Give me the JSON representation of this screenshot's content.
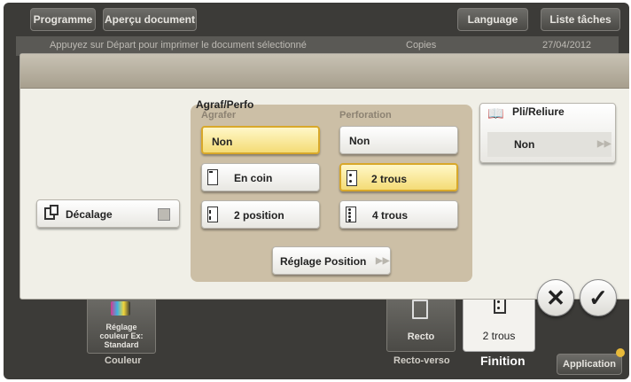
{
  "topbar": {
    "programme": "Programme",
    "apercu": "Aperçu document",
    "language": "Language",
    "liste_taches": "Liste tâches"
  },
  "jobstrip": {
    "message": "Appuyez sur Départ pour imprimer le document sélectionné",
    "copies": "Copies",
    "date": "27/04/2012"
  },
  "panel": {
    "group_title": "Agraf/Perfo",
    "agrafer": {
      "label": "Agrafer",
      "options": [
        "Non",
        "En coin",
        "2 position"
      ],
      "selected": "Non"
    },
    "perforation": {
      "label": "Perforation",
      "options": [
        "Non",
        "2 trous",
        "4 trous"
      ],
      "selected": "2 trous"
    },
    "reglage_position": "Réglage Position",
    "decalage": "Décalage",
    "pli_reliure": {
      "label": "Pli/Reliure",
      "value": "Non"
    }
  },
  "bottom": {
    "couleur_tile": "Réglage couleur Ex: Standard",
    "couleur_label": "Couleur",
    "recto_tile": "Recto",
    "recto_label": "Recto-verso",
    "finition_tile": "2 trous",
    "finition_label": "Finition",
    "application": "Application"
  },
  "icons": [
    "decalage-icon",
    "book-icon",
    "staple-corner-icon",
    "staple-2pos-icon",
    "punch-2-icon",
    "punch-4-icon",
    "cancel-icon",
    "ok-icon"
  ]
}
